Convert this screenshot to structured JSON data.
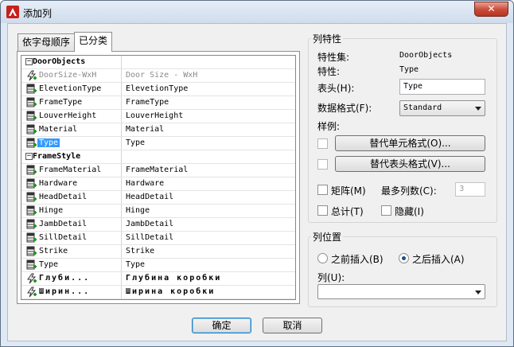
{
  "window": {
    "title": "添加列",
    "close": "✕"
  },
  "tabs": [
    {
      "label": "依字母顺序",
      "active": false
    },
    {
      "label": "已分类",
      "active": true
    }
  ],
  "list": {
    "rows": [
      {
        "type": "group",
        "label": "DoorObjects",
        "value": ""
      },
      {
        "type": "auto",
        "label": "DoorSize-WxH",
        "value": "Door Size - WxH",
        "dim": true
      },
      {
        "type": "prop",
        "label": "ElevetionType",
        "value": "ElevetionType"
      },
      {
        "type": "prop",
        "label": "FrameType",
        "value": "FrameType"
      },
      {
        "type": "prop",
        "label": "LouverHeight",
        "value": "LouverHeight"
      },
      {
        "type": "prop",
        "label": "Material",
        "value": "Material"
      },
      {
        "type": "prop",
        "label": "Type",
        "value": "Type",
        "selected": true
      },
      {
        "type": "group",
        "label": "FrameStyle",
        "value": ""
      },
      {
        "type": "prop",
        "label": "FrameMaterial",
        "value": "FrameMaterial"
      },
      {
        "type": "prop",
        "label": "Hardware",
        "value": "Hardware"
      },
      {
        "type": "prop",
        "label": "HeadDetail",
        "value": "HeadDetail"
      },
      {
        "type": "prop",
        "label": "Hinge",
        "value": "Hinge"
      },
      {
        "type": "prop",
        "label": "JambDetail",
        "value": "JambDetail"
      },
      {
        "type": "prop",
        "label": "SillDetail",
        "value": "SillDetail"
      },
      {
        "type": "prop",
        "label": "Strike",
        "value": "Strike"
      },
      {
        "type": "prop",
        "label": "Type",
        "value": "Type"
      },
      {
        "type": "auto",
        "label": "Глуби...",
        "value": "Глубина коробки",
        "cyr": true
      },
      {
        "type": "auto",
        "label": "Ширин...",
        "value": "Ширина коробки",
        "cyr": true
      }
    ]
  },
  "column_props": {
    "group_title": "列特性",
    "propset_label": "特性集:",
    "propset_value": "DoorObjects",
    "prop_label": "特性:",
    "prop_value": "Type",
    "header_label": "表头(H):",
    "header_value": "Type",
    "format_label": "数据格式(F):",
    "format_value": "Standard",
    "sample_label": "样例:",
    "override_cell_btn": "替代单元格式(O)...",
    "override_header_btn": "替代表头格式(V)...",
    "matrix_label": "矩阵(M)",
    "max_cols_label": "最多列数(C):",
    "max_cols_value": "3",
    "total_label": "总计(T)",
    "hide_label": "隐藏(I)"
  },
  "column_pos": {
    "group_title": "列位置",
    "before_label": "之前插入(B)",
    "after_label": "之后插入(A)",
    "column_label": "列(U):",
    "column_value": ""
  },
  "buttons": {
    "ok": "确定",
    "cancel": "取消"
  }
}
